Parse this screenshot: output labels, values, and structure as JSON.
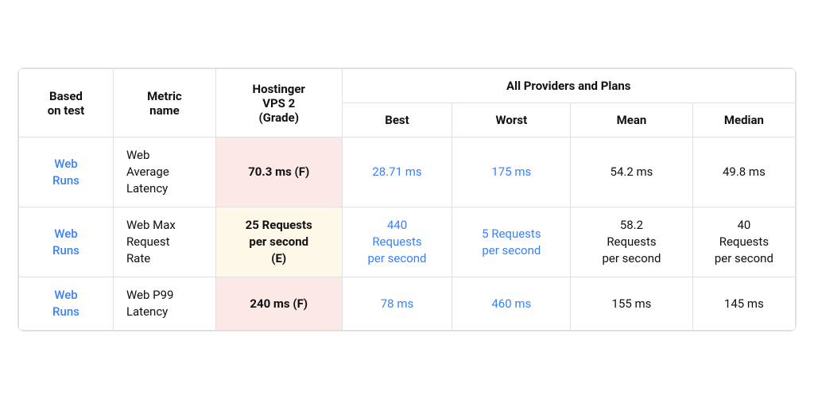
{
  "headers": {
    "col1": "Based\non test",
    "col2": "Metric\nname",
    "col3": "Hostinger\nVPS 2\n(Grade)",
    "all_providers": "All Providers and Plans",
    "best": "Best",
    "worst": "Worst",
    "mean": "Mean",
    "median": "Median"
  },
  "rows": [
    {
      "based": "Web\nRuns",
      "metric": "Web\nAverage\nLatency",
      "hostinger": "70.3 ms (F)",
      "hostinger_style": "pink",
      "best": "28.71 ms",
      "best_blue": true,
      "worst": "175 ms",
      "worst_blue": true,
      "mean": "54.2 ms",
      "mean_blue": false,
      "median": "49.8 ms",
      "median_blue": false
    },
    {
      "based": "Web\nRuns",
      "metric": "Web Max\nRequest\nRate",
      "hostinger": "25 Requests\nper second\n(E)",
      "hostinger_style": "yellow",
      "best": "440\nRequests\nper second",
      "best_blue": true,
      "worst": "5 Requests\nper second",
      "worst_blue": true,
      "mean": "58.2\nRequests\nper second",
      "mean_blue": false,
      "median": "40\nRequests\nper second",
      "median_blue": false
    },
    {
      "based": "Web\nRuns",
      "metric": "Web P99\nLatency",
      "hostinger": "240 ms (F)",
      "hostinger_style": "pink",
      "best": "78 ms",
      "best_blue": true,
      "worst": "460 ms",
      "worst_blue": true,
      "mean": "155 ms",
      "mean_blue": false,
      "median": "145 ms",
      "median_blue": false
    }
  ]
}
